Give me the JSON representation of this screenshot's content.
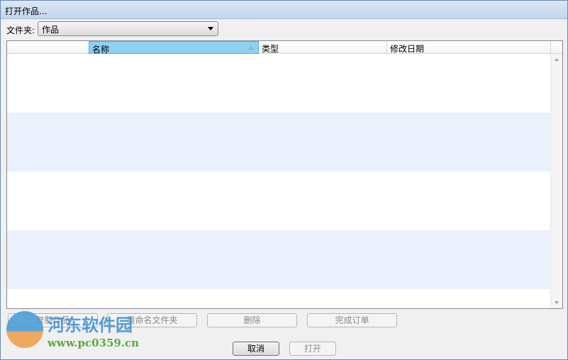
{
  "title": "打开作品...",
  "folder": {
    "label": "文件夹:",
    "value": "作品"
  },
  "columns": [
    "名称",
    "类型",
    "修改日期"
  ],
  "buttons": {
    "copy": "复制作品",
    "rename": "重命名文件夹",
    "delete": "删除",
    "complete": "完成订单",
    "cancel": "取消",
    "open": "打开"
  },
  "watermark": {
    "name": "河东软件园",
    "url": "www.pc0359.cn"
  }
}
